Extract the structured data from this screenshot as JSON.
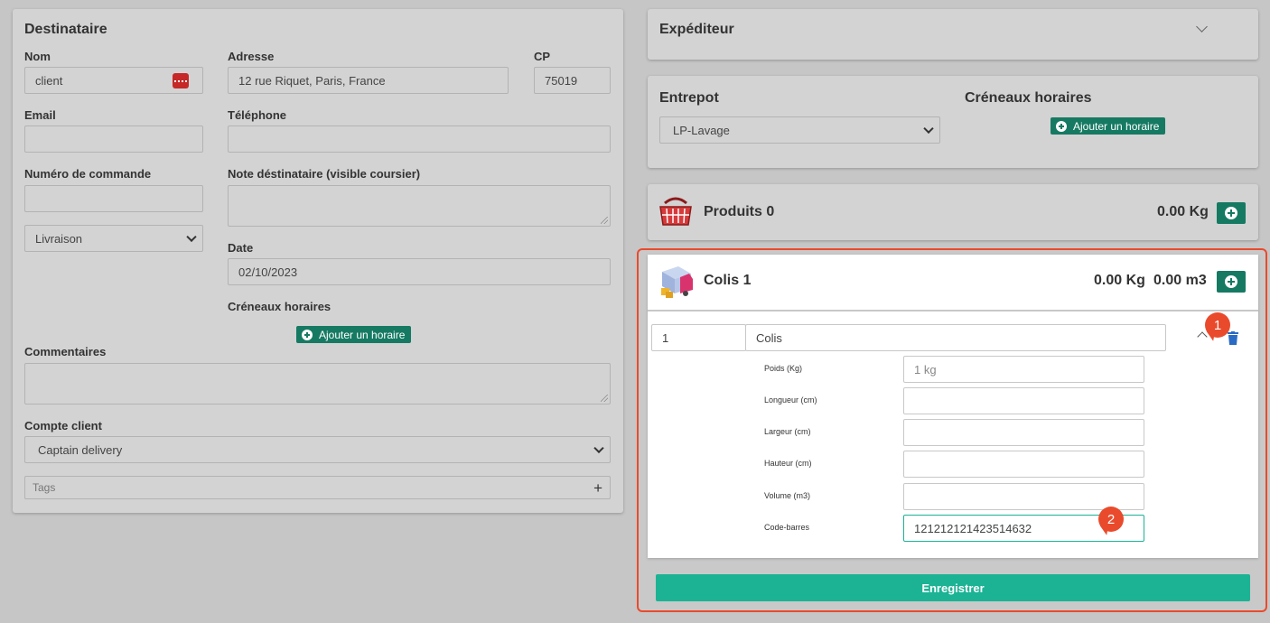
{
  "destinataire": {
    "title": "Destinataire",
    "nom_label": "Nom",
    "nom_value": "client",
    "adresse_label": "Adresse",
    "adresse_value": "12 rue Riquet, Paris, France",
    "cp_label": "CP",
    "cp_value": "75019",
    "email_label": "Email",
    "email_value": "",
    "telephone_label": "Téléphone",
    "telephone_value": "",
    "commande_label": "Numéro de commande",
    "commande_value": "",
    "note_label": "Note déstinataire (visible coursier)",
    "note_value": "",
    "type_selected": "Livraison",
    "date_label": "Date",
    "date_value": "02/10/2023",
    "creneaux_label": "Créneaux horaires",
    "add_horaire_label": "Ajouter un horaire",
    "commentaires_label": "Commentaires",
    "commentaires_value": "",
    "compte_label": "Compte client",
    "compte_selected": "Captain delivery",
    "tags_placeholder": "Tags",
    "tags_add": "+"
  },
  "expediteur": {
    "title": "Expéditeur"
  },
  "entrepot": {
    "title": "Entrepot",
    "selected": "LP-Lavage",
    "creneaux_title": "Créneaux horaires",
    "add_horaire_label": "Ajouter un horaire"
  },
  "produits": {
    "title": "Produits 0",
    "weight": "0.00 Kg"
  },
  "colis": {
    "title": "Colis 1",
    "weight": "0.00 Kg",
    "volume": "0.00 m3",
    "row": {
      "quantity": "1",
      "type": "Colis",
      "fields": [
        {
          "label": "Poids (Kg)",
          "value": "",
          "placeholder": "1 kg"
        },
        {
          "label": "Longueur (cm)",
          "value": "",
          "placeholder": ""
        },
        {
          "label": "Largeur (cm)",
          "value": "",
          "placeholder": ""
        },
        {
          "label": "Hauteur (cm)",
          "value": "",
          "placeholder": ""
        },
        {
          "label": "Volume (m3)",
          "value": "",
          "placeholder": ""
        },
        {
          "label": "Code-barres",
          "value": "121212121423514632",
          "placeholder": ""
        }
      ]
    },
    "save_label": "Enregistrer"
  },
  "annotations": {
    "badge1": "1",
    "badge2": "2"
  },
  "colors": {
    "accent": "#167a63",
    "save": "#1bb394",
    "highlight": "#ea4a2c",
    "delete": "#2a6bc4"
  }
}
